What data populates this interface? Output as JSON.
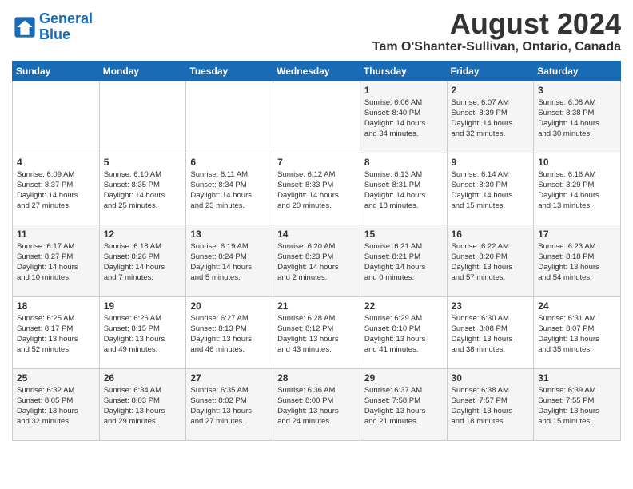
{
  "header": {
    "logo_line1": "General",
    "logo_line2": "Blue",
    "month_year": "August 2024",
    "location": "Tam O'Shanter-Sullivan, Ontario, Canada"
  },
  "weekdays": [
    "Sunday",
    "Monday",
    "Tuesday",
    "Wednesday",
    "Thursday",
    "Friday",
    "Saturday"
  ],
  "weeks": [
    [
      {
        "day": "",
        "info": ""
      },
      {
        "day": "",
        "info": ""
      },
      {
        "day": "",
        "info": ""
      },
      {
        "day": "",
        "info": ""
      },
      {
        "day": "1",
        "info": "Sunrise: 6:06 AM\nSunset: 8:40 PM\nDaylight: 14 hours\nand 34 minutes."
      },
      {
        "day": "2",
        "info": "Sunrise: 6:07 AM\nSunset: 8:39 PM\nDaylight: 14 hours\nand 32 minutes."
      },
      {
        "day": "3",
        "info": "Sunrise: 6:08 AM\nSunset: 8:38 PM\nDaylight: 14 hours\nand 30 minutes."
      }
    ],
    [
      {
        "day": "4",
        "info": "Sunrise: 6:09 AM\nSunset: 8:37 PM\nDaylight: 14 hours\nand 27 minutes."
      },
      {
        "day": "5",
        "info": "Sunrise: 6:10 AM\nSunset: 8:35 PM\nDaylight: 14 hours\nand 25 minutes."
      },
      {
        "day": "6",
        "info": "Sunrise: 6:11 AM\nSunset: 8:34 PM\nDaylight: 14 hours\nand 23 minutes."
      },
      {
        "day": "7",
        "info": "Sunrise: 6:12 AM\nSunset: 8:33 PM\nDaylight: 14 hours\nand 20 minutes."
      },
      {
        "day": "8",
        "info": "Sunrise: 6:13 AM\nSunset: 8:31 PM\nDaylight: 14 hours\nand 18 minutes."
      },
      {
        "day": "9",
        "info": "Sunrise: 6:14 AM\nSunset: 8:30 PM\nDaylight: 14 hours\nand 15 minutes."
      },
      {
        "day": "10",
        "info": "Sunrise: 6:16 AM\nSunset: 8:29 PM\nDaylight: 14 hours\nand 13 minutes."
      }
    ],
    [
      {
        "day": "11",
        "info": "Sunrise: 6:17 AM\nSunset: 8:27 PM\nDaylight: 14 hours\nand 10 minutes."
      },
      {
        "day": "12",
        "info": "Sunrise: 6:18 AM\nSunset: 8:26 PM\nDaylight: 14 hours\nand 7 minutes."
      },
      {
        "day": "13",
        "info": "Sunrise: 6:19 AM\nSunset: 8:24 PM\nDaylight: 14 hours\nand 5 minutes."
      },
      {
        "day": "14",
        "info": "Sunrise: 6:20 AM\nSunset: 8:23 PM\nDaylight: 14 hours\nand 2 minutes."
      },
      {
        "day": "15",
        "info": "Sunrise: 6:21 AM\nSunset: 8:21 PM\nDaylight: 14 hours\nand 0 minutes."
      },
      {
        "day": "16",
        "info": "Sunrise: 6:22 AM\nSunset: 8:20 PM\nDaylight: 13 hours\nand 57 minutes."
      },
      {
        "day": "17",
        "info": "Sunrise: 6:23 AM\nSunset: 8:18 PM\nDaylight: 13 hours\nand 54 minutes."
      }
    ],
    [
      {
        "day": "18",
        "info": "Sunrise: 6:25 AM\nSunset: 8:17 PM\nDaylight: 13 hours\nand 52 minutes."
      },
      {
        "day": "19",
        "info": "Sunrise: 6:26 AM\nSunset: 8:15 PM\nDaylight: 13 hours\nand 49 minutes."
      },
      {
        "day": "20",
        "info": "Sunrise: 6:27 AM\nSunset: 8:13 PM\nDaylight: 13 hours\nand 46 minutes."
      },
      {
        "day": "21",
        "info": "Sunrise: 6:28 AM\nSunset: 8:12 PM\nDaylight: 13 hours\nand 43 minutes."
      },
      {
        "day": "22",
        "info": "Sunrise: 6:29 AM\nSunset: 8:10 PM\nDaylight: 13 hours\nand 41 minutes."
      },
      {
        "day": "23",
        "info": "Sunrise: 6:30 AM\nSunset: 8:08 PM\nDaylight: 13 hours\nand 38 minutes."
      },
      {
        "day": "24",
        "info": "Sunrise: 6:31 AM\nSunset: 8:07 PM\nDaylight: 13 hours\nand 35 minutes."
      }
    ],
    [
      {
        "day": "25",
        "info": "Sunrise: 6:32 AM\nSunset: 8:05 PM\nDaylight: 13 hours\nand 32 minutes."
      },
      {
        "day": "26",
        "info": "Sunrise: 6:34 AM\nSunset: 8:03 PM\nDaylight: 13 hours\nand 29 minutes."
      },
      {
        "day": "27",
        "info": "Sunrise: 6:35 AM\nSunset: 8:02 PM\nDaylight: 13 hours\nand 27 minutes."
      },
      {
        "day": "28",
        "info": "Sunrise: 6:36 AM\nSunset: 8:00 PM\nDaylight: 13 hours\nand 24 minutes."
      },
      {
        "day": "29",
        "info": "Sunrise: 6:37 AM\nSunset: 7:58 PM\nDaylight: 13 hours\nand 21 minutes."
      },
      {
        "day": "30",
        "info": "Sunrise: 6:38 AM\nSunset: 7:57 PM\nDaylight: 13 hours\nand 18 minutes."
      },
      {
        "day": "31",
        "info": "Sunrise: 6:39 AM\nSunset: 7:55 PM\nDaylight: 13 hours\nand 15 minutes."
      }
    ]
  ]
}
